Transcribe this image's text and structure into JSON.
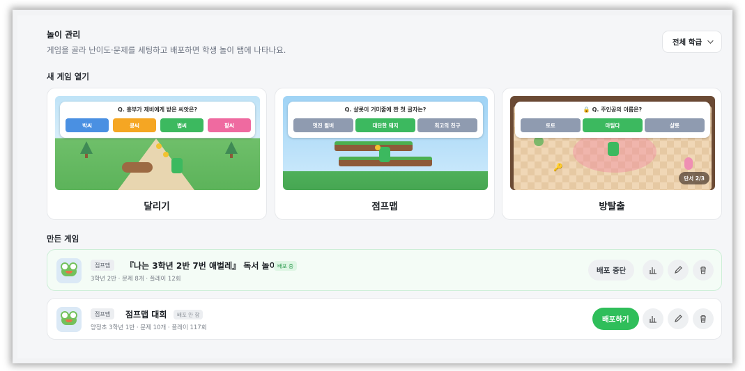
{
  "header": {
    "title": "놀이 관리",
    "subtitle": "게임을 골라 난이도·문제를 세팅하고 배포하면 학생 놀이 탭에 나타나요.",
    "class_filter": "전체 학급"
  },
  "new_games": {
    "label": "새 게임 열기",
    "games": [
      {
        "name": "달리기",
        "question": "Q. 흥부가 제비에게 받은 씨앗은?",
        "options": [
          "박씨",
          "콩씨",
          "볍씨",
          "팥씨"
        ]
      },
      {
        "name": "점프맵",
        "question": "Q. 샬롯이 거미줄에 짠 첫 글자는?",
        "options": [
          "멋진 윌버",
          "대단한 돼지",
          "최고의 친구"
        ]
      },
      {
        "name": "방탈출",
        "question": "Q. 주인공의 이름은?",
        "options": [
          "토토",
          "마틸다",
          "샬롯"
        ],
        "stage": "단서 2/3"
      }
    ]
  },
  "made_games": {
    "label": "만든 게임",
    "items": [
      {
        "type": "점프맵",
        "title": "『나는 3학년 2반 7번 애벌레』 독서 놀이",
        "status": "배포 중",
        "meta": "3학년 2반 · 문제 8개 · 플레이 12회",
        "action": "배포 중단"
      },
      {
        "type": "점프맵",
        "title": "점프맵 대회",
        "status": "배포 안 함",
        "meta": "양정초 3학년 1반 · 문제 10개 · 플레이 117회",
        "action": "배포하기"
      }
    ]
  },
  "colors": {
    "accent_green": "#2fbe5a",
    "opt_blue": "#4a90e2",
    "opt_orange": "#f5a623",
    "opt_green": "#3cb95f",
    "opt_pink": "#ef6aa0",
    "opt_gray": "#8f9bb0"
  }
}
